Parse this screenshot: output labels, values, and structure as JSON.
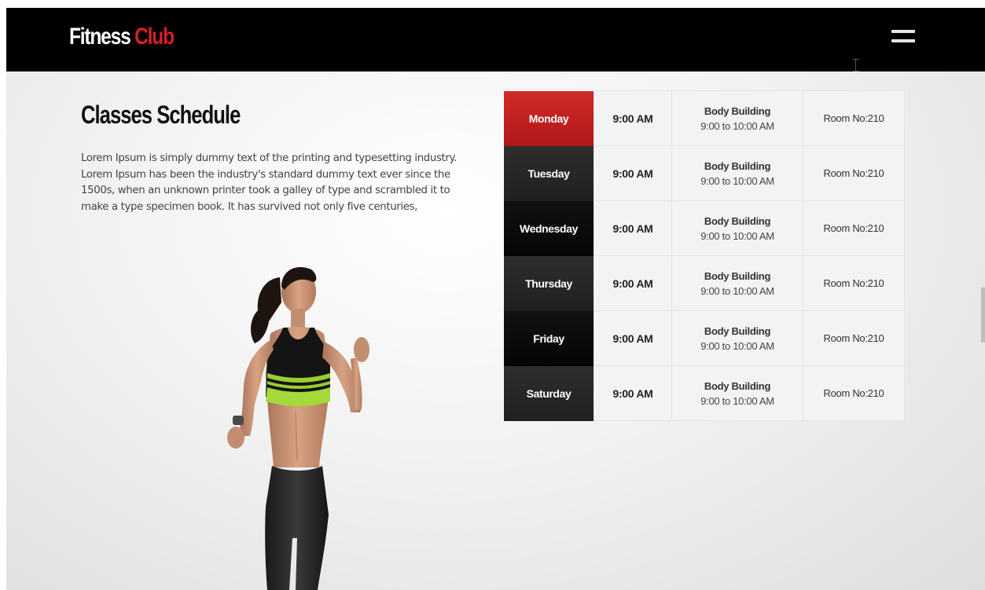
{
  "header": {
    "logo_part1": "Fitness",
    "logo_part2": "Club",
    "menu_icon": "hamburger-menu-icon"
  },
  "main": {
    "title": "Classes Schedule",
    "description": "Lorem Ipsum is simply dummy text of the printing and typesetting industry. Lorem Ipsum has been the industry's standard dummy text ever since the 1500s, when an unknown printer took a galley of type and scrambled it to make a type specimen book. It has survived not only five centuries,"
  },
  "schedule": [
    {
      "day": "Monday",
      "time": "9:00 AM",
      "class_name": "Body Building",
      "class_time": "9:00 to 10:00 AM",
      "room": "Room No:210"
    },
    {
      "day": "Tuesday",
      "time": "9:00 AM",
      "class_name": "Body Building",
      "class_time": "9:00 to 10:00 AM",
      "room": "Room No:210"
    },
    {
      "day": "Wednesday",
      "time": "9:00 AM",
      "class_name": "Body Building",
      "class_time": "9:00 to 10:00 AM",
      "room": "Room No:210"
    },
    {
      "day": "Thursday",
      "time": "9:00 AM",
      "class_name": "Body Building",
      "class_time": "9:00 to 10:00 AM",
      "room": "Room No:210"
    },
    {
      "day": "Friday",
      "time": "9:00 AM",
      "class_name": "Body Building",
      "class_time": "9:00 to 10:00 AM",
      "room": "Room No:210"
    },
    {
      "day": "Saturday",
      "time": "9:00 AM",
      "class_name": "Body Building",
      "class_time": "9:00 to 10:00 AM",
      "room": "Room No:210"
    }
  ],
  "colors": {
    "accent": "#d61f26",
    "header_bg": "#000000",
    "day_dark": "#0a0a0a",
    "day_gray": "#262626",
    "day_active": "#c11f1f"
  }
}
